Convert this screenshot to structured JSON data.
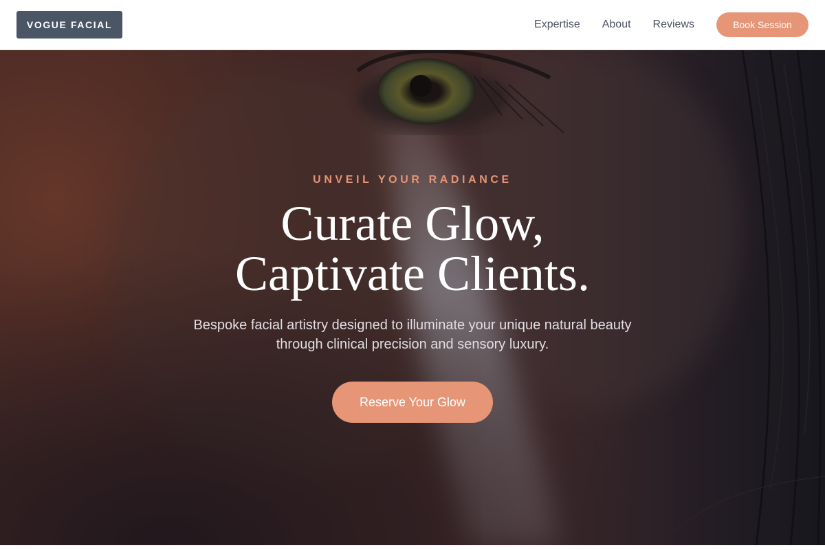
{
  "header": {
    "logo_text": "VOGUE FACIAL",
    "nav": [
      {
        "label": "Expertise"
      },
      {
        "label": "About"
      },
      {
        "label": "Reviews"
      }
    ],
    "book_label": "Book Session"
  },
  "hero": {
    "eyebrow": "UNVEIL YOUR RADIANCE",
    "headline_line1": "Curate Glow,",
    "headline_line2": "Captivate Clients.",
    "subtitle": "Bespoke facial artistry designed to illuminate your unique natural beauty through clinical precision and sensory luxury.",
    "cta_label": "Reserve Your Glow",
    "image_description": "close-up-face-eye-photo"
  },
  "colors": {
    "accent": "#e69576",
    "logo_bg": "#4a5666",
    "nav_text": "#4a5263",
    "hero_text": "#ffffff"
  }
}
